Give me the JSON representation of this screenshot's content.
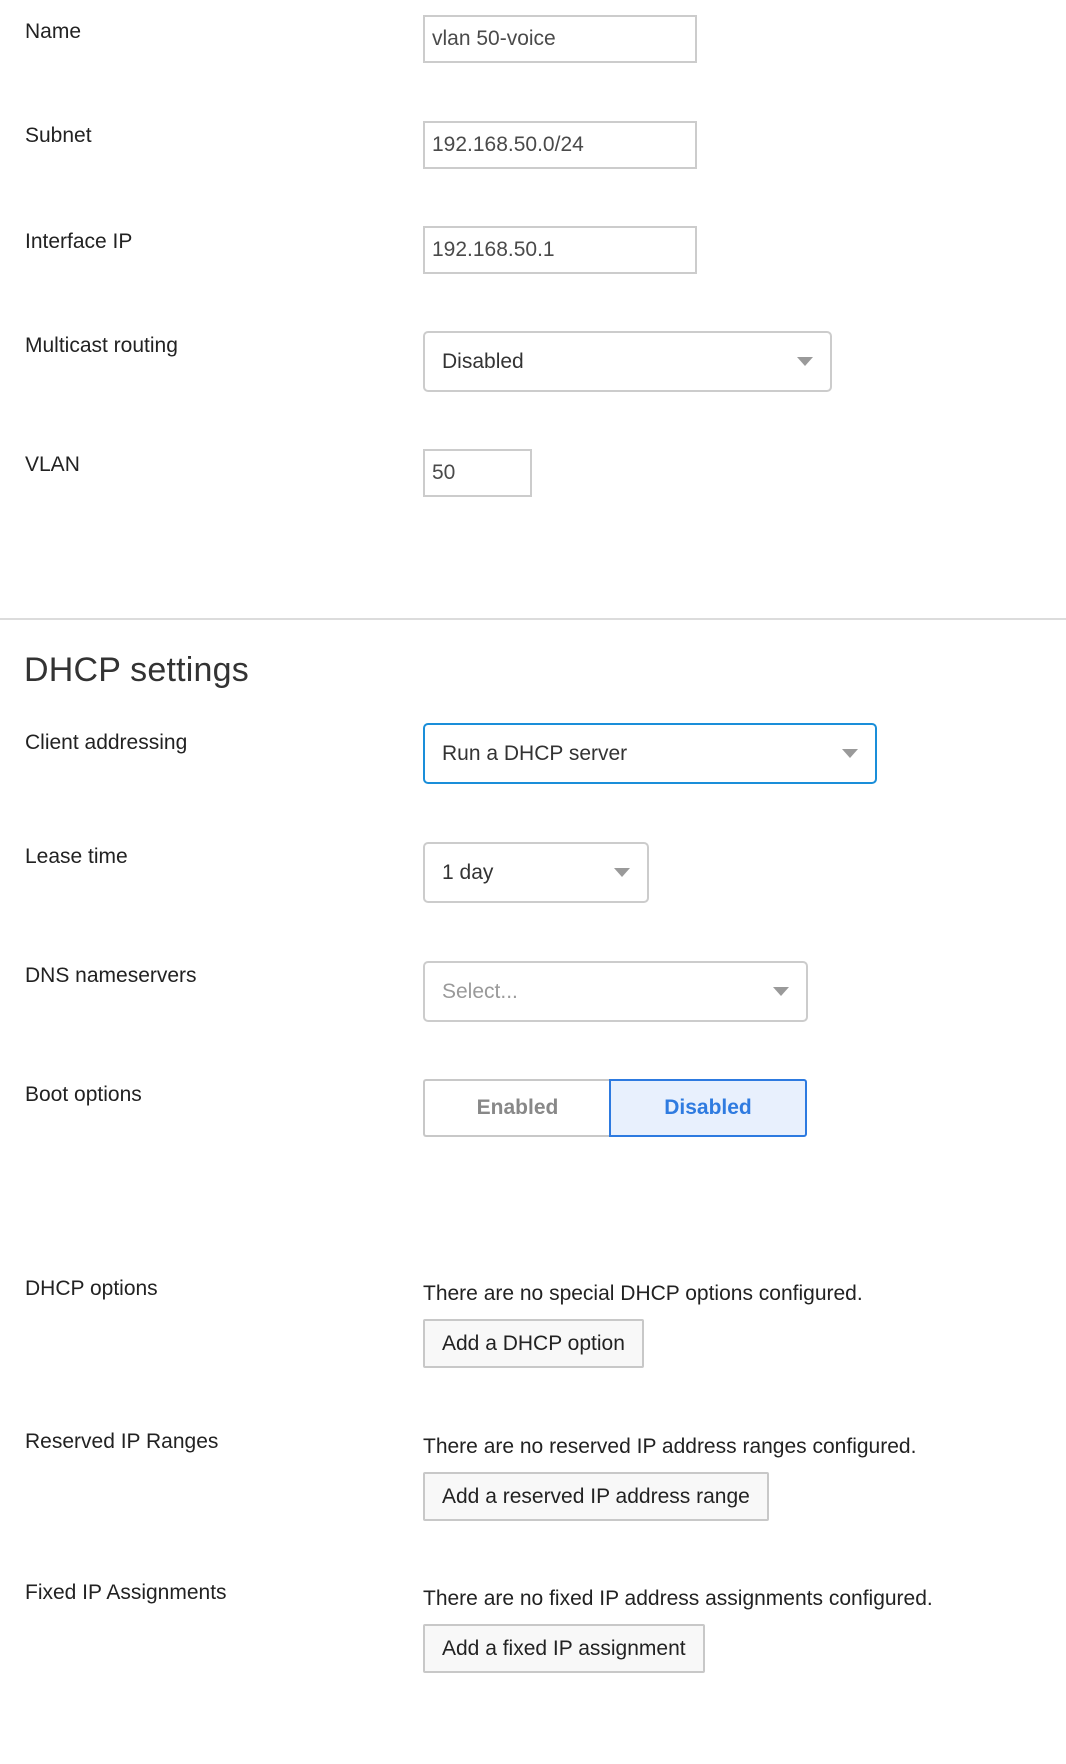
{
  "general": {
    "name": {
      "label": "Name",
      "value": "vlan 50-voice"
    },
    "subnet": {
      "label": "Subnet",
      "value": "192.168.50.0/24"
    },
    "interface_ip": {
      "label": "Interface IP",
      "value": "192.168.50.1"
    },
    "multicast_routing": {
      "label": "Multicast routing",
      "selected": "Disabled"
    },
    "vlan": {
      "label": "VLAN",
      "value": "50"
    }
  },
  "dhcp": {
    "title": "DHCP settings",
    "client_addressing": {
      "label": "Client addressing",
      "selected": "Run a DHCP server"
    },
    "lease_time": {
      "label": "Lease time",
      "selected": "1 day"
    },
    "dns_nameservers": {
      "label": "DNS nameservers",
      "placeholder": "Select..."
    },
    "boot_options": {
      "label": "Boot options",
      "options": [
        "Enabled",
        "Disabled"
      ],
      "selected": "Disabled"
    },
    "dhcp_options": {
      "label": "DHCP options",
      "empty_text": "There are no special DHCP options configured.",
      "button": "Add a DHCP option"
    },
    "reserved_ranges": {
      "label": "Reserved IP Ranges",
      "empty_text": "There are no reserved IP address ranges configured.",
      "button": "Add a reserved IP address range"
    },
    "fixed_assignments": {
      "label": "Fixed IP Assignments",
      "empty_text": "There are no fixed IP address assignments configured.",
      "button": "Add a fixed IP assignment"
    }
  },
  "colors": {
    "focus_border": "#1a8ed9",
    "toggle_active_bg": "#e8f0fd",
    "toggle_active_text": "#2f7be0"
  }
}
